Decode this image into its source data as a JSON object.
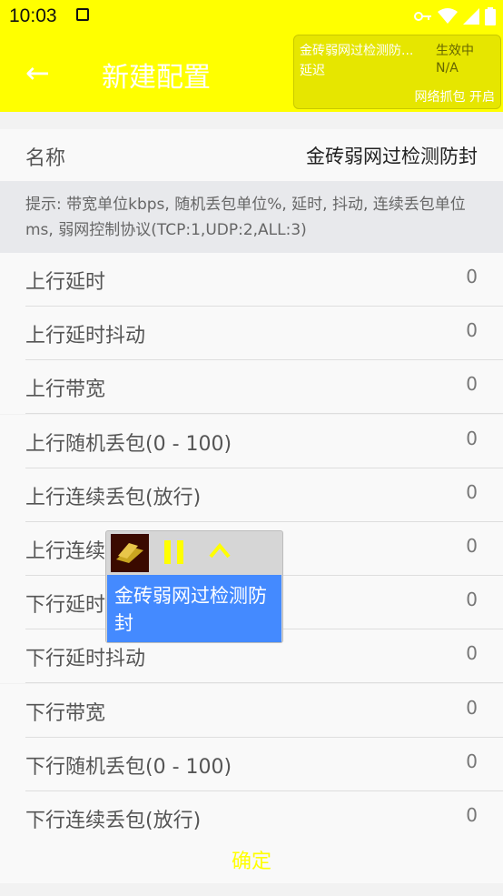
{
  "status": {
    "time": "10:03"
  },
  "header": {
    "back_icon": "arrow-left-icon",
    "title": "新建配置"
  },
  "floating_panel": {
    "name": "金砖弱网过检测防...",
    "state": "生效中",
    "delay_label": "延迟",
    "delay_value": "N/A",
    "capture": "网络抓包 开启"
  },
  "name_row": {
    "label": "名称",
    "value": "金砖弱网过检测防封"
  },
  "hint": "提示: 带宽单位kbps, 随机丢包单位%, 延时, 抖动, 连续丢包单位ms, 弱网控制协议(TCP:1,UDP:2,ALL:3)",
  "rows": [
    {
      "label": "上行延时",
      "value": "0"
    },
    {
      "label": "上行延时抖动",
      "value": "0"
    },
    {
      "label": "上行带宽",
      "value": "0"
    },
    {
      "label": "上行随机丢包(0 - 100)",
      "value": "0"
    },
    {
      "label": "上行连续丢包(放行)",
      "value": "0"
    },
    {
      "label": "上行连续丢包(丢包)",
      "value": "0"
    },
    {
      "label": "下行延时",
      "value": "0"
    },
    {
      "label": "下行延时抖动",
      "value": "0"
    },
    {
      "label": "下行带宽",
      "value": "0"
    },
    {
      "label": "下行随机丢包(0 - 100)",
      "value": "0"
    },
    {
      "label": "下行连续丢包(放行)",
      "value": "0"
    }
  ],
  "overlay": {
    "text": "金砖弱网过检测防封"
  },
  "footer": {
    "confirm": "确定"
  }
}
